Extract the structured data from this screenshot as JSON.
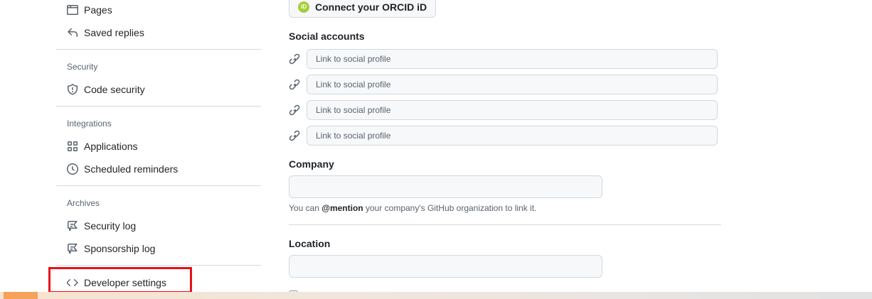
{
  "sidebar": {
    "items": {
      "pages": "Pages",
      "saved_replies": "Saved replies",
      "code_security": "Code security",
      "applications": "Applications",
      "scheduled_reminders": "Scheduled reminders",
      "security_log": "Security log",
      "sponsorship_log": "Sponsorship log",
      "developer_settings": "Developer settings"
    },
    "headings": {
      "security": "Security",
      "integrations": "Integrations",
      "archives": "Archives"
    },
    "highlight_color": "#e8101a"
  },
  "main": {
    "orcid_button": {
      "logo": "iD",
      "label": "Connect your ORCID iD"
    },
    "social_accounts": {
      "label": "Social accounts",
      "fields": [
        {
          "placeholder": "Link to social profile",
          "value": ""
        },
        {
          "placeholder": "Link to social profile",
          "value": ""
        },
        {
          "placeholder": "Link to social profile",
          "value": ""
        },
        {
          "placeholder": "Link to social profile",
          "value": ""
        }
      ]
    },
    "company": {
      "label": "Company",
      "value": "",
      "note_prefix": "You can ",
      "note_mention": "@mention",
      "note_suffix": " your company's GitHub organization to link it."
    },
    "location": {
      "label": "Location",
      "value": ""
    }
  },
  "icons": {
    "pages": "browser-icon",
    "saved_replies": "reply-icon",
    "code_security": "shield-icon",
    "applications": "apps-grid-icon",
    "scheduled_reminders": "clock-icon",
    "security_log": "log-icon",
    "sponsorship_log": "log-icon",
    "developer_settings": "code-icon",
    "social_link": "link-icon"
  }
}
